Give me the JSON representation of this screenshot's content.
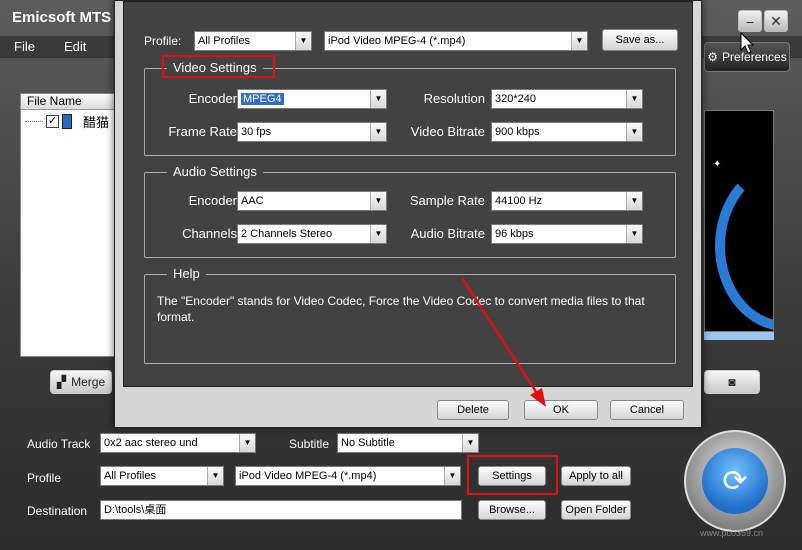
{
  "main_window": {
    "title": "Emicsoft MTS",
    "minimize_glyph": "⎯",
    "close_glyph": "✕",
    "menu": [
      "File",
      "Edit"
    ],
    "file_list": {
      "header": "File Name",
      "row_check": "✓",
      "row_name": "醋猫"
    },
    "merge_label": "Merge",
    "preferences_label": "Preferences",
    "audio_track_label": "Audio Track",
    "audio_track_value": "0x2 aac stereo und",
    "subtitle_label": "Subtitle",
    "subtitle_value": "No Subtitle",
    "profile_label": "Profile",
    "profile_category": "All Profiles",
    "profile_value": "iPod Video MPEG-4 (*.mp4)",
    "settings_label": "Settings",
    "apply_all_label": "Apply to all",
    "destination_label": "Destination",
    "destination_value": "D:\\tools\\桌面",
    "browse_label": "Browse...",
    "open_folder_label": "Open Folder",
    "watermark": "www.pc0359.cn"
  },
  "dialog": {
    "profile_label": "Profile:",
    "profile_category": "All Profiles",
    "profile_value": "iPod Video MPEG-4 (*.mp4)",
    "save_as_label": "Save as...",
    "video": {
      "title": "Video Settings",
      "encoder_label": "Encoder",
      "encoder_value": "MPEG4",
      "resolution_label": "Resolution",
      "resolution_value": "320*240",
      "frame_rate_label": "Frame Rate",
      "frame_rate_value": "30 fps",
      "video_bitrate_label": "Video Bitrate",
      "video_bitrate_value": "900 kbps"
    },
    "audio": {
      "title": "Audio Settings",
      "encoder_label": "Encoder",
      "encoder_value": "AAC",
      "sample_rate_label": "Sample Rate",
      "sample_rate_value": "44100 Hz",
      "channels_label": "Channels",
      "channels_value": "2 Channels Stereo",
      "audio_bitrate_label": "Audio Bitrate",
      "audio_bitrate_value": "96 kbps"
    },
    "help": {
      "title": "Help",
      "text": "The \"Encoder\" stands for Video Codec, Force the Video Codec to convert media files to that format."
    },
    "delete_label": "Delete",
    "ok_label": "OK",
    "cancel_label": "Cancel"
  },
  "icons": {
    "dropdown": "▼",
    "merge": "▞",
    "camera": "◙",
    "convert": "⟳",
    "star": "✦",
    "gear": "⚙"
  },
  "colors": {
    "annotation": "#e01010",
    "selection": "#2f6ec3",
    "accent_blue": "#1e6ec8"
  }
}
